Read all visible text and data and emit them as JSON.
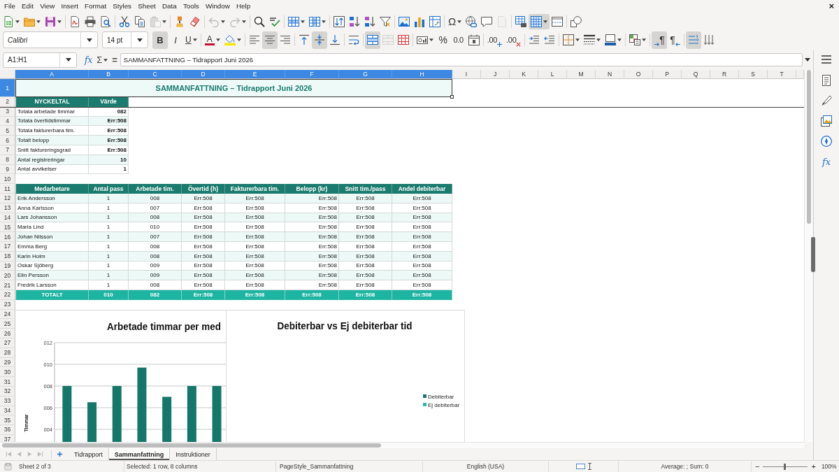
{
  "menu_bar": {
    "items": [
      "File",
      "Edit",
      "View",
      "Insert",
      "Format",
      "Styles",
      "Sheet",
      "Data",
      "Tools",
      "Window",
      "Help"
    ],
    "close": "×"
  },
  "standard_toolbar": [
    {
      "pressed": false,
      "disabled": false
    },
    {
      "pressed": false,
      "disabled": false
    },
    {
      "pressed": false,
      "disabled": false
    },
    {
      "pressed": false,
      "disabled": false
    },
    {
      "pressed": false,
      "disabled": false
    },
    {
      "pressed": false,
      "disabled": false
    },
    {
      "pressed": false,
      "disabled": false
    },
    {
      "pressed": false,
      "disabled": false
    },
    {
      "pressed": false,
      "disabled": true
    },
    {
      "pressed": false,
      "disabled": false
    },
    {
      "pressed": false,
      "disabled": false
    },
    {
      "pressed": false,
      "disabled": true
    },
    {
      "pressed": false,
      "disabled": true
    },
    {
      "pressed": false,
      "disabled": false
    },
    {
      "pressed": false,
      "disabled": false
    },
    {
      "pressed": false,
      "disabled": false
    },
    {
      "pressed": false,
      "disabled": false
    },
    {
      "pressed": false,
      "disabled": false
    },
    {
      "pressed": false,
      "disabled": false
    },
    {
      "pressed": false,
      "disabled": false
    },
    {
      "pressed": false,
      "disabled": false
    },
    {
      "pressed": false,
      "disabled": false
    },
    {
      "pressed": false,
      "disabled": false
    },
    {
      "pressed": false,
      "disabled": false
    },
    {
      "label": "Ω",
      "pressed": false,
      "disabled": false
    },
    {
      "pressed": false,
      "disabled": false
    },
    {
      "pressed": false,
      "disabled": false
    },
    {
      "pressed": false,
      "disabled": true
    },
    {
      "pressed": false,
      "disabled": false
    },
    {
      "pressed": true,
      "disabled": false
    },
    {
      "pressed": false,
      "disabled": false
    },
    {
      "pressed": false,
      "disabled": false
    }
  ],
  "formatting_toolbar": {
    "font_name": "Calibri",
    "font_size": "14 pt",
    "buttons": [
      {
        "label": "B",
        "pressed": true,
        "disabled": false
      },
      {
        "label": "I",
        "pressed": false,
        "disabled": false
      },
      {
        "label": "U",
        "pressed": false,
        "disabled": false
      },
      {
        "label": "A",
        "pressed": false,
        "disabled": false
      },
      {
        "pressed": false,
        "disabled": false
      },
      {
        "pressed": false,
        "disabled": false
      },
      {
        "pressed": true,
        "disabled": false
      },
      {
        "pressed": false,
        "disabled": false
      },
      {
        "pressed": false,
        "disabled": false
      },
      {
        "pressed": true,
        "disabled": false
      },
      {
        "pressed": false,
        "disabled": false
      },
      {
        "pressed": false,
        "disabled": false
      },
      {
        "pressed": true,
        "disabled": false
      },
      {
        "pressed": false,
        "disabled": true
      },
      {
        "pressed": false,
        "disabled": false
      },
      {
        "pressed": false,
        "disabled": false
      },
      {
        "label": "%",
        "pressed": false,
        "disabled": false
      },
      {
        "label": "0.0",
        "pressed": false,
        "disabled": false
      },
      {
        "pressed": false,
        "disabled": false
      },
      {
        "label": ".00",
        "pressed": false,
        "disabled": false
      },
      {
        "label": ".00",
        "pressed": false,
        "disabled": false
      },
      {
        "pressed": false,
        "disabled": false
      },
      {
        "pressed": false,
        "disabled": false
      },
      {
        "pressed": false,
        "disabled": false
      },
      {
        "pressed": false,
        "disabled": false
      },
      {
        "pressed": false,
        "disabled": false
      },
      {
        "pressed": false,
        "disabled": false
      },
      {
        "label": "¶",
        "pressed": true,
        "disabled": false
      },
      {
        "label": "¶",
        "pressed": false,
        "disabled": false
      },
      {
        "pressed": true,
        "disabled": false
      },
      {
        "pressed": false,
        "disabled": false
      }
    ]
  },
  "formula_bar": {
    "name_box": "A1:H1",
    "function_wizard": "fx",
    "sum": "Σ",
    "formula": "=",
    "content": "SAMMANFATTNING – Tidrapport Juni 2026"
  },
  "sheet": {
    "columns": [
      {
        "label": "A",
        "selected": true
      },
      {
        "label": "B",
        "selected": true
      },
      {
        "label": "C",
        "selected": true
      },
      {
        "label": "D",
        "selected": true
      },
      {
        "label": "E",
        "selected": true
      },
      {
        "label": "F",
        "selected": true
      },
      {
        "label": "G",
        "selected": true
      },
      {
        "label": "H",
        "selected": true
      },
      {
        "label": "I",
        "selected": false
      },
      {
        "label": "J",
        "selected": false
      },
      {
        "label": "K",
        "selected": false
      },
      {
        "label": "L",
        "selected": false
      },
      {
        "label": "M",
        "selected": false
      },
      {
        "label": "N",
        "selected": false
      },
      {
        "label": "O",
        "selected": false
      },
      {
        "label": "P",
        "selected": false
      },
      {
        "label": "Q",
        "selected": false
      },
      {
        "label": "R",
        "selected": false
      },
      {
        "label": "S",
        "selected": false
      },
      {
        "label": "T",
        "selected": false
      }
    ],
    "rows": [
      {
        "label": "1",
        "selected": true
      },
      {
        "label": "2",
        "selected": false
      },
      {
        "label": "3",
        "selected": false
      },
      {
        "label": "4",
        "selected": false
      },
      {
        "label": "5",
        "selected": false
      },
      {
        "label": "6",
        "selected": false
      },
      {
        "label": "7",
        "selected": false
      },
      {
        "label": "8",
        "selected": false
      },
      {
        "label": "9",
        "selected": false
      },
      {
        "label": "10",
        "selected": false
      },
      {
        "label": "11",
        "selected": false
      },
      {
        "label": "12",
        "selected": false
      },
      {
        "label": "13",
        "selected": false
      },
      {
        "label": "14",
        "selected": false
      },
      {
        "label": "15",
        "selected": false
      },
      {
        "label": "16",
        "selected": false
      },
      {
        "label": "17",
        "selected": false
      },
      {
        "label": "18",
        "selected": false
      },
      {
        "label": "19",
        "selected": false
      },
      {
        "label": "20",
        "selected": false
      },
      {
        "label": "21",
        "selected": false
      },
      {
        "label": "22",
        "selected": false
      },
      {
        "label": "23",
        "selected": false
      },
      {
        "label": "24",
        "selected": false
      },
      {
        "label": "25",
        "selected": false
      },
      {
        "label": "26",
        "selected": false
      },
      {
        "label": "27",
        "selected": false
      },
      {
        "label": "28",
        "selected": false
      },
      {
        "label": "29",
        "selected": false
      },
      {
        "label": "30",
        "selected": false
      },
      {
        "label": "31",
        "selected": false
      },
      {
        "label": "32",
        "selected": false
      },
      {
        "label": "33",
        "selected": false
      },
      {
        "label": "34",
        "selected": false
      },
      {
        "label": "35",
        "selected": false
      },
      {
        "label": "36",
        "selected": false
      },
      {
        "label": "37",
        "selected": false
      }
    ],
    "title": {
      "text": "SAMMANFATTNING – Tidrapport Juni 2026",
      "selected": true
    },
    "key_figures": {
      "columns": [
        "NYCKELTAL",
        "Värde"
      ],
      "rows": [
        [
          "Totala arbetade timmar",
          "082"
        ],
        [
          "Totala övertidstimmar",
          "Err:508"
        ],
        [
          "Totala fakturerbara tim.",
          "Err:508"
        ],
        [
          "Totalt belopp",
          "Err:508"
        ],
        [
          "Snitt faktureringsgrad",
          "Err:508"
        ],
        [
          "Antal registreringar",
          "10"
        ],
        [
          "Antal avvikelser",
          "1"
        ]
      ]
    },
    "employees": {
      "columns": [
        "Medarbetare",
        "Antal pass",
        "Arbetade tim.",
        "Övertid (h)",
        "Fakturerbara tim.",
        "Belopp (kr)",
        "Snitt tim./pass",
        "Andel debiterbar"
      ],
      "rows": [
        [
          "Erik Andersson",
          "1",
          "008",
          "Err:508",
          "Err:508",
          "Err:508",
          "Err:508",
          "Err:508"
        ],
        [
          "Anna Karlsson",
          "1",
          "007",
          "Err:508",
          "Err:508",
          "Err:508",
          "Err:508",
          "Err:508"
        ],
        [
          "Lars Johansson",
          "1",
          "008",
          "Err:508",
          "Err:508",
          "Err:508",
          "Err:508",
          "Err:508"
        ],
        [
          "Maria Lind",
          "1",
          "010",
          "Err:508",
          "Err:508",
          "Err:508",
          "Err:508",
          "Err:508"
        ],
        [
          "Johan Nilsson",
          "1",
          "007",
          "Err:508",
          "Err:508",
          "Err:508",
          "Err:508",
          "Err:508"
        ],
        [
          "Emma Berg",
          "1",
          "008",
          "Err:508",
          "Err:508",
          "Err:508",
          "Err:508",
          "Err:508"
        ],
        [
          "Karin Holm",
          "1",
          "008",
          "Err:508",
          "Err:508",
          "Err:508",
          "Err:508",
          "Err:508"
        ],
        [
          "Oskar Sjöberg",
          "1",
          "009",
          "Err:508",
          "Err:508",
          "Err:508",
          "Err:508",
          "Err:508"
        ],
        [
          "Elin Persson",
          "1",
          "009",
          "Err:508",
          "Err:508",
          "Err:508",
          "Err:508",
          "Err:508"
        ],
        [
          "Fredrik Larsson",
          "1",
          "008",
          "Err:508",
          "Err:508",
          "Err:508",
          "Err:508",
          "Err:508"
        ]
      ],
      "total": [
        "TOTALT",
        "010",
        "082",
        "Err:508",
        "Err:508",
        "Err:508",
        "Err:508",
        "Err:508"
      ]
    },
    "charts": [
      {
        "kind": "plot",
        "chart_data": {
          "type": "bar",
          "title": "Arbetade timmar per med",
          "ylabel": "Timmar",
          "values": [
            8,
            6.5,
            8,
            9.7,
            7,
            8,
            8
          ],
          "ylim": [
            2.8,
            12
          ],
          "grid": true,
          "yticks": [
            {
              "value": 4,
              "label": "004"
            },
            {
              "value": 6,
              "label": "006"
            },
            {
              "value": 8,
              "label": "008"
            },
            {
              "value": 10,
              "label": "010"
            },
            {
              "value": 12,
              "label": "012"
            }
          ]
        }
      },
      {
        "kind": "blank",
        "title": "Debiterbar vs Ej debiterbar tid",
        "legend": [
          {
            "name": "Debiterbar",
            "color": "#17766a"
          },
          {
            "name": "Ej debiterbar",
            "color": "#2bbcab"
          }
        ]
      }
    ]
  },
  "sidebar": [
    {
      "selected": false
    },
    {
      "selected": false
    },
    {
      "selected": false
    },
    {
      "selected": false
    },
    {
      "label": "fx",
      "selected": false
    }
  ],
  "tab_navigation": [
    {
      "disabled": true
    },
    {
      "disabled": true
    },
    {
      "disabled": true
    },
    {
      "disabled": true
    }
  ],
  "sheet_tabs": [
    {
      "label": "Tidrapport",
      "selected": false
    },
    {
      "label": "Sammanfattning",
      "selected": true
    },
    {
      "label": "Instruktioner",
      "selected": false
    }
  ],
  "status_bar": {
    "sheet": "Sheet 2 of 3",
    "selection": "Selected: 1 row, 8 columns",
    "page_style": "PageStyle_Sammanfattning",
    "language": "English (USA)",
    "summary": "Average: ; Sum: 0",
    "zoom": {
      "minus": "−",
      "plus": "+",
      "level": 0.48,
      "value": "100%"
    }
  }
}
